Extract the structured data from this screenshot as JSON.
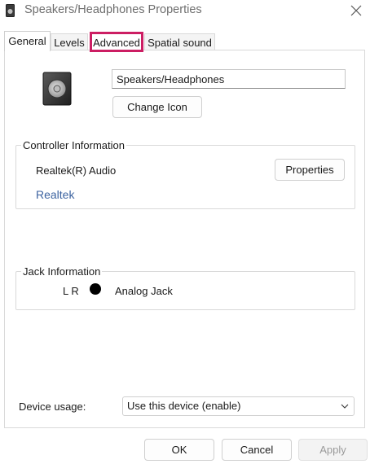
{
  "window": {
    "title": "Speakers/Headphones Properties",
    "icon": "speaker-icon",
    "close_icon": "close-icon"
  },
  "tabs": [
    {
      "label": "General",
      "active": true
    },
    {
      "label": "Levels",
      "active": false
    },
    {
      "label": "Advanced",
      "active": false,
      "highlighted": true
    },
    {
      "label": "Spatial sound",
      "active": false
    }
  ],
  "general": {
    "device_name_value": "Speakers/Headphones",
    "change_icon_label": "Change Icon"
  },
  "controller": {
    "group_title": "Controller Information",
    "name": "Realtek(R) Audio",
    "properties_label": "Properties",
    "vendor_link": "Realtek"
  },
  "jack": {
    "group_title": "Jack Information",
    "channels": "L R",
    "connector_label": "Analog Jack"
  },
  "device_usage": {
    "label": "Device usage:",
    "selected": "Use this device (enable)"
  },
  "footer": {
    "ok_label": "OK",
    "cancel_label": "Cancel",
    "apply_label": "Apply"
  },
  "colors": {
    "highlight": "#cc1e63",
    "link": "#3c63a0"
  }
}
